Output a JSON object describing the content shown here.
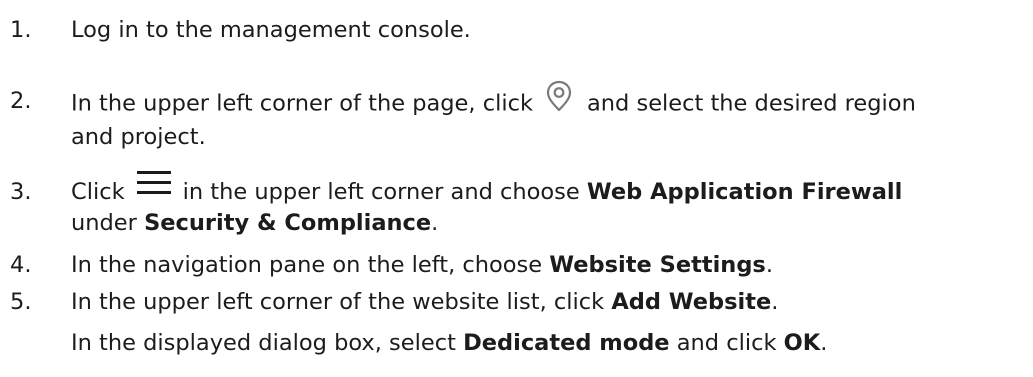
{
  "steps": [
    {
      "num": "1.",
      "text": "Log in to the management console."
    },
    {
      "num": "2.",
      "before": "In the upper left corner of the page, click",
      "after": "and select the desired region",
      "line2": "and project.",
      "icon": "location-pin-icon"
    },
    {
      "num": "3.",
      "before": "Click",
      "after": "in the upper left corner and choose",
      "bold1": "Web Application Firewall",
      "line2_pre": "under",
      "bold2": "Security & Compliance",
      "line2_post": ".",
      "icon": "hamburger-menu-icon"
    },
    {
      "num": "4.",
      "pre": "In the navigation pane on the left, choose",
      "bold": "Website Settings",
      "post": "."
    },
    {
      "num": "5.",
      "pre": "In the upper left corner of the website list, click",
      "bold": "Add Website",
      "post": "."
    }
  ],
  "followup": {
    "pre": "In the displayed dialog box, select",
    "bold1": "Dedicated mode",
    "mid": "and click",
    "bold2": "OK",
    "post": "."
  },
  "colors": {
    "text": "#1c1c1c",
    "pin_icon": "#7a7a7a",
    "menu_icon": "#1a1a1a"
  }
}
